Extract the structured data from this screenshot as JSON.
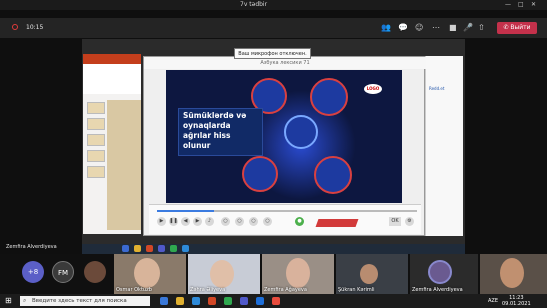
{
  "window": {
    "title": "7v tədbir",
    "controls": [
      "—",
      "□",
      "✕"
    ]
  },
  "call": {
    "timer": "10:15",
    "leave_label": "Выйти",
    "icons": [
      "participants-icon",
      "chat-icon",
      "reactions-icon",
      "more-icon",
      "camera-icon",
      "mic-icon",
      "share-icon"
    ]
  },
  "shared_screen": {
    "tooltip": "Ваш микрофон отключен.",
    "player_title": "Азбука лексики 71",
    "video": {
      "caption": "Sümüklərdə və oynaqlarda ağrılar hiss olunur",
      "logo": "LOGO"
    },
    "progress": 0.22,
    "controls": {
      "ok_label": "OK",
      "red_label": ""
    },
    "right_panel": {
      "item1": "Redd.et"
    },
    "presenter_name": "Zemfira Alverdiyeva"
  },
  "participants": [
    {
      "label": "+8",
      "type": "counter",
      "color": "#5b5fc7"
    },
    {
      "label": "FM",
      "type": "initials",
      "color": "#3a3a3a"
    },
    {
      "label": "",
      "type": "avatar",
      "color": "#6b4a3a"
    },
    {
      "label": "Osmar Oktuzb",
      "type": "tile"
    },
    {
      "label": "Zəhra Əliyeva",
      "type": "tile"
    },
    {
      "label": "Zemfira Ağayeva",
      "type": "tile"
    },
    {
      "label": "Şükran Kərimli",
      "type": "tile"
    },
    {
      "label": "Zemfira Alverdiyeva",
      "type": "tile"
    },
    {
      "label": "",
      "type": "tile"
    }
  ],
  "taskbar": {
    "search_placeholder": "Введите здесь текст для поиска",
    "time": "11:23",
    "date": "09.01.2021",
    "lang": "AZE"
  }
}
